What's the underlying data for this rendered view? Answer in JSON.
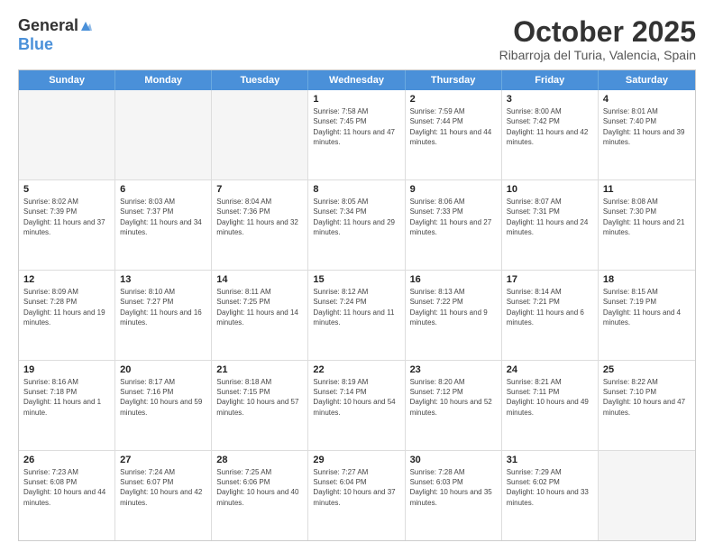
{
  "logo": {
    "general": "General",
    "blue": "Blue"
  },
  "header": {
    "month": "October 2025",
    "location": "Ribarroja del Turia, Valencia, Spain"
  },
  "days_of_week": [
    "Sunday",
    "Monday",
    "Tuesday",
    "Wednesday",
    "Thursday",
    "Friday",
    "Saturday"
  ],
  "weeks": [
    [
      {
        "day": "",
        "info": ""
      },
      {
        "day": "",
        "info": ""
      },
      {
        "day": "",
        "info": ""
      },
      {
        "day": "1",
        "info": "Sunrise: 7:58 AM\nSunset: 7:45 PM\nDaylight: 11 hours and 47 minutes."
      },
      {
        "day": "2",
        "info": "Sunrise: 7:59 AM\nSunset: 7:44 PM\nDaylight: 11 hours and 44 minutes."
      },
      {
        "day": "3",
        "info": "Sunrise: 8:00 AM\nSunset: 7:42 PM\nDaylight: 11 hours and 42 minutes."
      },
      {
        "day": "4",
        "info": "Sunrise: 8:01 AM\nSunset: 7:40 PM\nDaylight: 11 hours and 39 minutes."
      }
    ],
    [
      {
        "day": "5",
        "info": "Sunrise: 8:02 AM\nSunset: 7:39 PM\nDaylight: 11 hours and 37 minutes."
      },
      {
        "day": "6",
        "info": "Sunrise: 8:03 AM\nSunset: 7:37 PM\nDaylight: 11 hours and 34 minutes."
      },
      {
        "day": "7",
        "info": "Sunrise: 8:04 AM\nSunset: 7:36 PM\nDaylight: 11 hours and 32 minutes."
      },
      {
        "day": "8",
        "info": "Sunrise: 8:05 AM\nSunset: 7:34 PM\nDaylight: 11 hours and 29 minutes."
      },
      {
        "day": "9",
        "info": "Sunrise: 8:06 AM\nSunset: 7:33 PM\nDaylight: 11 hours and 27 minutes."
      },
      {
        "day": "10",
        "info": "Sunrise: 8:07 AM\nSunset: 7:31 PM\nDaylight: 11 hours and 24 minutes."
      },
      {
        "day": "11",
        "info": "Sunrise: 8:08 AM\nSunset: 7:30 PM\nDaylight: 11 hours and 21 minutes."
      }
    ],
    [
      {
        "day": "12",
        "info": "Sunrise: 8:09 AM\nSunset: 7:28 PM\nDaylight: 11 hours and 19 minutes."
      },
      {
        "day": "13",
        "info": "Sunrise: 8:10 AM\nSunset: 7:27 PM\nDaylight: 11 hours and 16 minutes."
      },
      {
        "day": "14",
        "info": "Sunrise: 8:11 AM\nSunset: 7:25 PM\nDaylight: 11 hours and 14 minutes."
      },
      {
        "day": "15",
        "info": "Sunrise: 8:12 AM\nSunset: 7:24 PM\nDaylight: 11 hours and 11 minutes."
      },
      {
        "day": "16",
        "info": "Sunrise: 8:13 AM\nSunset: 7:22 PM\nDaylight: 11 hours and 9 minutes."
      },
      {
        "day": "17",
        "info": "Sunrise: 8:14 AM\nSunset: 7:21 PM\nDaylight: 11 hours and 6 minutes."
      },
      {
        "day": "18",
        "info": "Sunrise: 8:15 AM\nSunset: 7:19 PM\nDaylight: 11 hours and 4 minutes."
      }
    ],
    [
      {
        "day": "19",
        "info": "Sunrise: 8:16 AM\nSunset: 7:18 PM\nDaylight: 11 hours and 1 minute."
      },
      {
        "day": "20",
        "info": "Sunrise: 8:17 AM\nSunset: 7:16 PM\nDaylight: 10 hours and 59 minutes."
      },
      {
        "day": "21",
        "info": "Sunrise: 8:18 AM\nSunset: 7:15 PM\nDaylight: 10 hours and 57 minutes."
      },
      {
        "day": "22",
        "info": "Sunrise: 8:19 AM\nSunset: 7:14 PM\nDaylight: 10 hours and 54 minutes."
      },
      {
        "day": "23",
        "info": "Sunrise: 8:20 AM\nSunset: 7:12 PM\nDaylight: 10 hours and 52 minutes."
      },
      {
        "day": "24",
        "info": "Sunrise: 8:21 AM\nSunset: 7:11 PM\nDaylight: 10 hours and 49 minutes."
      },
      {
        "day": "25",
        "info": "Sunrise: 8:22 AM\nSunset: 7:10 PM\nDaylight: 10 hours and 47 minutes."
      }
    ],
    [
      {
        "day": "26",
        "info": "Sunrise: 7:23 AM\nSunset: 6:08 PM\nDaylight: 10 hours and 44 minutes."
      },
      {
        "day": "27",
        "info": "Sunrise: 7:24 AM\nSunset: 6:07 PM\nDaylight: 10 hours and 42 minutes."
      },
      {
        "day": "28",
        "info": "Sunrise: 7:25 AM\nSunset: 6:06 PM\nDaylight: 10 hours and 40 minutes."
      },
      {
        "day": "29",
        "info": "Sunrise: 7:27 AM\nSunset: 6:04 PM\nDaylight: 10 hours and 37 minutes."
      },
      {
        "day": "30",
        "info": "Sunrise: 7:28 AM\nSunset: 6:03 PM\nDaylight: 10 hours and 35 minutes."
      },
      {
        "day": "31",
        "info": "Sunrise: 7:29 AM\nSunset: 6:02 PM\nDaylight: 10 hours and 33 minutes."
      },
      {
        "day": "",
        "info": ""
      }
    ]
  ]
}
